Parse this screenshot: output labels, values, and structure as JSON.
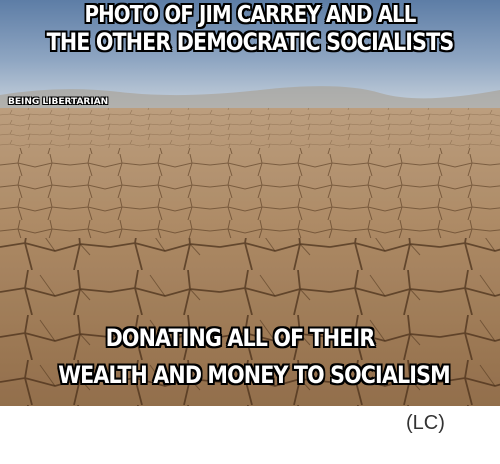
{
  "meme": {
    "top_line_1": "PHOTO OF JIM CARREY AND ALL",
    "top_line_2": "THE OTHER DEMOCRATIC SOCIALISTS",
    "watermark": "BEING LIBERTARIAN",
    "bottom_line_1": "DONATING ALL OF THEIR",
    "bottom_line_2": "WEALTH AND MONEY TO SOCIALISM"
  },
  "post": {
    "caption": "(LC)"
  },
  "colors": {
    "sky_top": "#5d7da6",
    "sky_horizon": "#c9d3dd",
    "ground_far": "#c8a886",
    "ground_near": "#9c7650",
    "crack": "#5a3c22"
  }
}
